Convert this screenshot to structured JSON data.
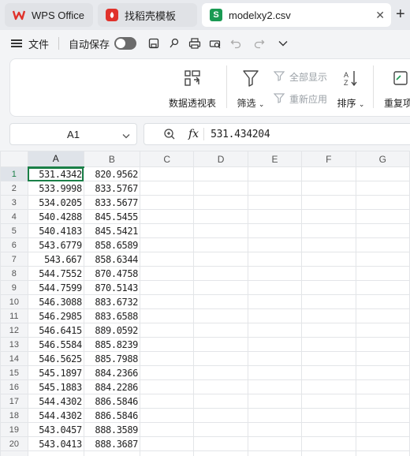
{
  "tabs": [
    {
      "label": "WPS Office",
      "icon": "wps-logo-icon",
      "color": "#e0322b"
    },
    {
      "label": "找稻壳模板",
      "icon": "docer-logo-icon",
      "color": "#e0322b"
    },
    {
      "label": "modelxy2.csv",
      "icon": "spreadsheet-file-icon",
      "color": "#1a9a53",
      "icon_letter": "S"
    }
  ],
  "menu": {
    "file_label": "文件",
    "autosave_label": "自动保存"
  },
  "ribbon": {
    "pivot_label": "数据透视表",
    "filter_label": "筛选",
    "show_all_label": "全部显示",
    "reapply_label": "重新应用",
    "sort_label": "排序",
    "duplicates_label": "重复项"
  },
  "formula_bar": {
    "cell_ref": "A1",
    "fx_label": "fx",
    "value": "531.434204"
  },
  "sheet": {
    "columns": [
      "A",
      "B",
      "C",
      "D",
      "E",
      "F",
      "G"
    ],
    "active_column": "A",
    "active_row": 1,
    "rows": [
      [
        "531.4342",
        "820.9562"
      ],
      [
        "533.9998",
        "833.5767"
      ],
      [
        "534.0205",
        "833.5677"
      ],
      [
        "540.4288",
        "845.5455"
      ],
      [
        "540.4183",
        "845.5421"
      ],
      [
        "543.6779",
        "858.6589"
      ],
      [
        "543.667",
        "858.6344"
      ],
      [
        "544.7552",
        "870.4758"
      ],
      [
        "544.7599",
        "870.5143"
      ],
      [
        "546.3088",
        "883.6732"
      ],
      [
        "546.2985",
        "883.6588"
      ],
      [
        "546.6415",
        "889.0592"
      ],
      [
        "546.5584",
        "885.8239"
      ],
      [
        "546.5625",
        "885.7988"
      ],
      [
        "545.1897",
        "884.2366"
      ],
      [
        "545.1883",
        "884.2286"
      ],
      [
        "544.4302",
        "886.5846"
      ],
      [
        "544.4302",
        "886.5846"
      ],
      [
        "543.0457",
        "888.3589"
      ],
      [
        "543.0413",
        "888.3687"
      ]
    ]
  },
  "colors": {
    "accent_green": "#1a7f47",
    "wps_red": "#e0322b"
  }
}
